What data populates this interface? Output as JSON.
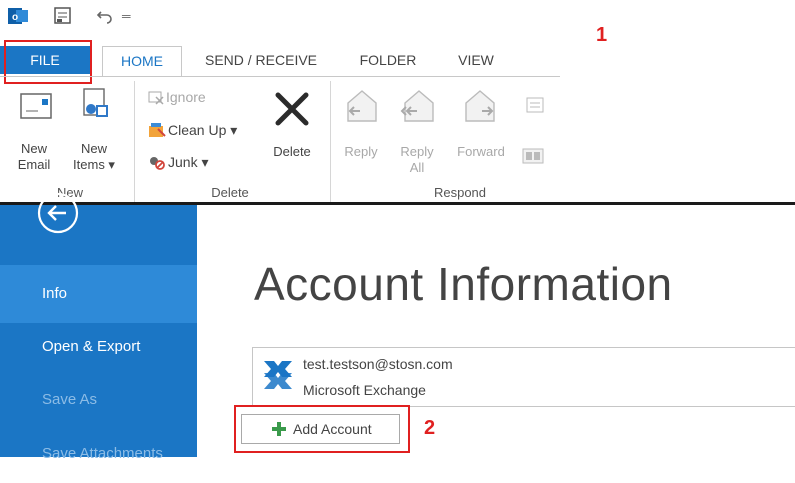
{
  "ribbon": {
    "tabs": [
      "FILE",
      "HOME",
      "SEND / RECEIVE",
      "FOLDER",
      "VIEW"
    ],
    "new_group": {
      "name": "New",
      "new_email_line1": "New",
      "new_email_line2": "Email",
      "new_items_line1": "New",
      "new_items_line2": "Items ▾"
    },
    "delete_group": {
      "name": "Delete",
      "ignore": "Ignore",
      "clean_up": "Clean Up ▾",
      "junk": "Junk ▾",
      "delete": "Delete"
    },
    "respond_group": {
      "name": "Respond",
      "reply": "Reply",
      "reply_all_line1": "Reply",
      "reply_all_line2": "All",
      "forward": "Forward"
    }
  },
  "annotations": {
    "step1": "1",
    "step2": "2"
  },
  "backstage": {
    "nav": [
      "Info",
      "Open & Export",
      "Save As",
      "Save Attachments"
    ],
    "title": "Account Information",
    "account": {
      "email": "test.testson@stosn.com",
      "type": "Microsoft Exchange"
    },
    "add_account": "Add Account"
  },
  "colors": {
    "accent": "#1b76c5",
    "nav_selected": "#2e8ad8",
    "annotation": "#e02020"
  }
}
